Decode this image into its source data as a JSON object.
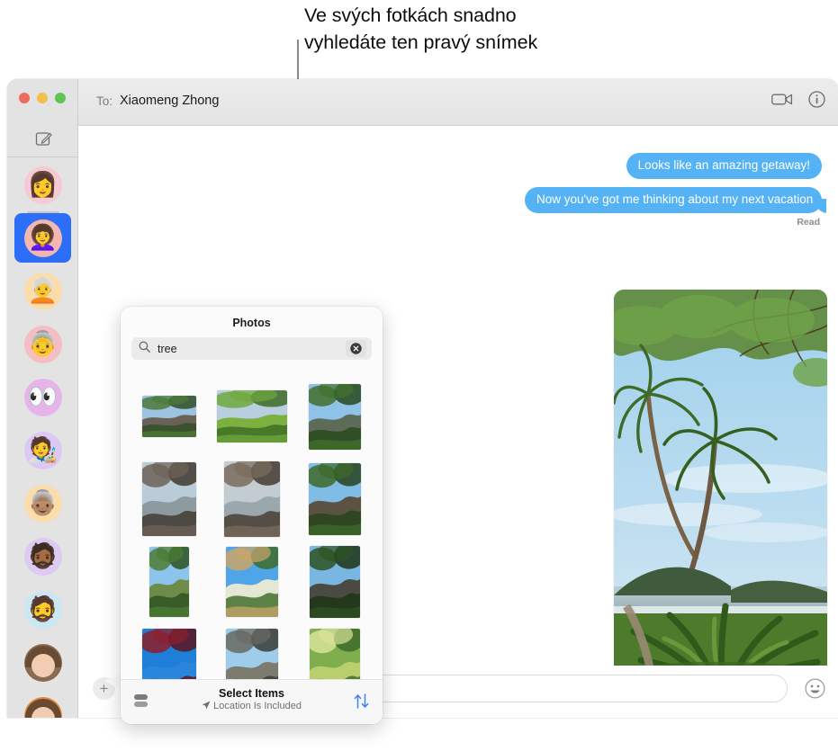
{
  "callout": {
    "text": "Ve svých fotkách snadno\nvyhledáte ten pravý snímek"
  },
  "window": {
    "titlebar": {
      "to_label": "To:",
      "recipient": "Xiaomeng Zhong",
      "facetime_icon": "video-camera-icon",
      "info_icon": "info-circle-icon"
    },
    "sidebar": {
      "compose_icon": "compose-icon",
      "traffic_lights": [
        "close",
        "minimize",
        "zoom"
      ],
      "conversations": [
        {
          "name": "conversation-1",
          "bg": "#f6c9d3",
          "face": "👩",
          "selected": false
        },
        {
          "name": "conversation-2",
          "bg": "#f4b7b0",
          "face": "👩‍🦱",
          "selected": true
        },
        {
          "name": "conversation-3",
          "bg": "#fbdcaa",
          "face": "🧑‍🦳",
          "selected": false
        },
        {
          "name": "conversation-4",
          "bg": "#f3bfc4",
          "face": "👵",
          "selected": false
        },
        {
          "name": "conversation-5",
          "bg": "#e6b4ea",
          "face": "👀",
          "selected": false
        },
        {
          "name": "conversation-6",
          "bg": "#dcc8f2",
          "face": "🧑‍🎨",
          "selected": false
        },
        {
          "name": "conversation-7",
          "bg": "#fbdcaa",
          "face": "👵🏽",
          "selected": false
        },
        {
          "name": "conversation-8",
          "bg": "#ddc9f2",
          "face": "🧔🏾",
          "selected": false
        },
        {
          "name": "conversation-9",
          "bg": "#c9e8f4",
          "face": "🧔",
          "selected": false
        },
        {
          "name": "conversation-10",
          "bg": "#8c6a52",
          "face": "",
          "selected": false
        },
        {
          "name": "conversation-11",
          "bg": "#e08c3a",
          "face": "",
          "selected": false
        }
      ]
    },
    "messages": [
      {
        "text": "Looks like an amazing getaway!",
        "sender": "me",
        "tail": false
      },
      {
        "text": "Now you've got me thinking about my next vacation…",
        "sender": "me",
        "tail": true
      }
    ],
    "read_receipt": "Read",
    "attachment": {
      "name": "palm-trees-beach-photo",
      "description": "Palm trees and tropical plants by the ocean"
    },
    "inputbar": {
      "plus_icon": "plus-icon",
      "message_placeholder": "",
      "emoji_icon": "emoji-smiley-icon"
    }
  },
  "popover": {
    "title": "Photos",
    "search": {
      "icon": "search-icon",
      "value": "tree",
      "placeholder": "Search",
      "clear_icon": "clear-circle-icon"
    },
    "grid": [
      [
        {
          "name": "photo-forest-rocks",
          "w": 60,
          "h": 46,
          "sky": "#9dc3e0",
          "g1": "#4f7a3a",
          "g2": "#2f4f26",
          "ground": "#6b6257"
        },
        {
          "name": "photo-green-meadow",
          "w": 78,
          "h": 58,
          "sky": "#b9cfe0",
          "g1": "#6fa83e",
          "g2": "#3d6b24",
          "ground": "#7cb13f"
        },
        {
          "name": "photo-palm-river",
          "w": 58,
          "h": 73,
          "sky": "#8fc2e8",
          "g1": "#43702c",
          "g2": "#27491c",
          "ground": "#5d6b58"
        }
      ],
      [
        {
          "name": "photo-coastal-cliffs",
          "w": 60,
          "h": 82,
          "sky": "#b9ccd8",
          "g1": "#6d6257",
          "g2": "#3f3830",
          "ground": "#8d9aa0"
        },
        {
          "name": "photo-sea-stacks",
          "w": 62,
          "h": 84,
          "sky": "#c3ccd2",
          "g1": "#7a6c5c",
          "g2": "#453b31",
          "ground": "#9aa7ad"
        },
        {
          "name": "photo-jungle-stream",
          "w": 58,
          "h": 80,
          "sky": "#7fbce6",
          "g1": "#3e6a2a",
          "g2": "#26431b",
          "ground": "#5b5244"
        }
      ],
      [
        {
          "name": "photo-palm-sky",
          "w": 44,
          "h": 78,
          "sky": "#8cc4ec",
          "g1": "#4c7c35",
          "g2": "#2c5220",
          "ground": "#6f8b4a"
        },
        {
          "name": "photo-dog-in-flowers",
          "w": 58,
          "h": 78,
          "sky": "#4ea5e8",
          "g1": "#caa56a",
          "g2": "#3f6b2a",
          "ground": "#e3e7d4"
        },
        {
          "name": "photo-beach-path",
          "w": 56,
          "h": 80,
          "sky": "#79b7e2",
          "g1": "#2f5222",
          "g2": "#1c3416",
          "ground": "#4a4a42"
        }
      ],
      [
        {
          "name": "photo-red-leaves-sky",
          "w": 60,
          "h": 80,
          "sky": "#1f7fd8",
          "g1": "#8c1f2d",
          "g2": "#5c1420",
          "ground": "#2a86dd"
        },
        {
          "name": "photo-black-sand-beach",
          "w": 58,
          "h": 80,
          "sky": "#9dcdea",
          "g1": "#6a6a62",
          "g2": "#3c3c36",
          "ground": "#7d7a70"
        },
        {
          "name": "photo-white-flower",
          "w": 56,
          "h": 80,
          "sky": "#7fae4e",
          "g1": "#d8e39a",
          "g2": "#3e6b28",
          "ground": "#b9cf6e"
        }
      ]
    ],
    "footer": {
      "stack_icon": "stack-view-icon",
      "title": "Select Items",
      "location_icon": "location-arrow-icon",
      "subtitle": "Location Is Included",
      "sort_icon": "sort-arrows-icon",
      "sort_color": "#3a84f2"
    }
  }
}
